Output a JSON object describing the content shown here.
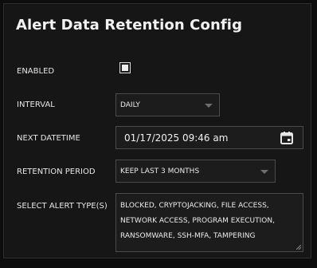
{
  "title": "Alert Data Retention Config",
  "enabled": {
    "label": "ENABLED",
    "checked": true
  },
  "interval": {
    "label": "INTERVAL",
    "value": "DAILY"
  },
  "next_datetime": {
    "label": "NEXT DATETIME",
    "value": "01/17/2025 09:46 am",
    "icon": "calendar-icon"
  },
  "retention_period": {
    "label": "RETENTION PERIOD",
    "value": "KEEP LAST 3 MONTHS"
  },
  "alert_types": {
    "label": "SELECT ALERT TYPE(S)",
    "value": "BLOCKED, CRYPTOJACKING, FILE ACCESS, NETWORK ACCESS, PROGRAM EXECUTION, RANSOMWARE, SSH-MFA, TAMPERING"
  },
  "colors": {
    "background": "#161616",
    "border": "#4a4a4a",
    "text": "#e6e6e6"
  }
}
